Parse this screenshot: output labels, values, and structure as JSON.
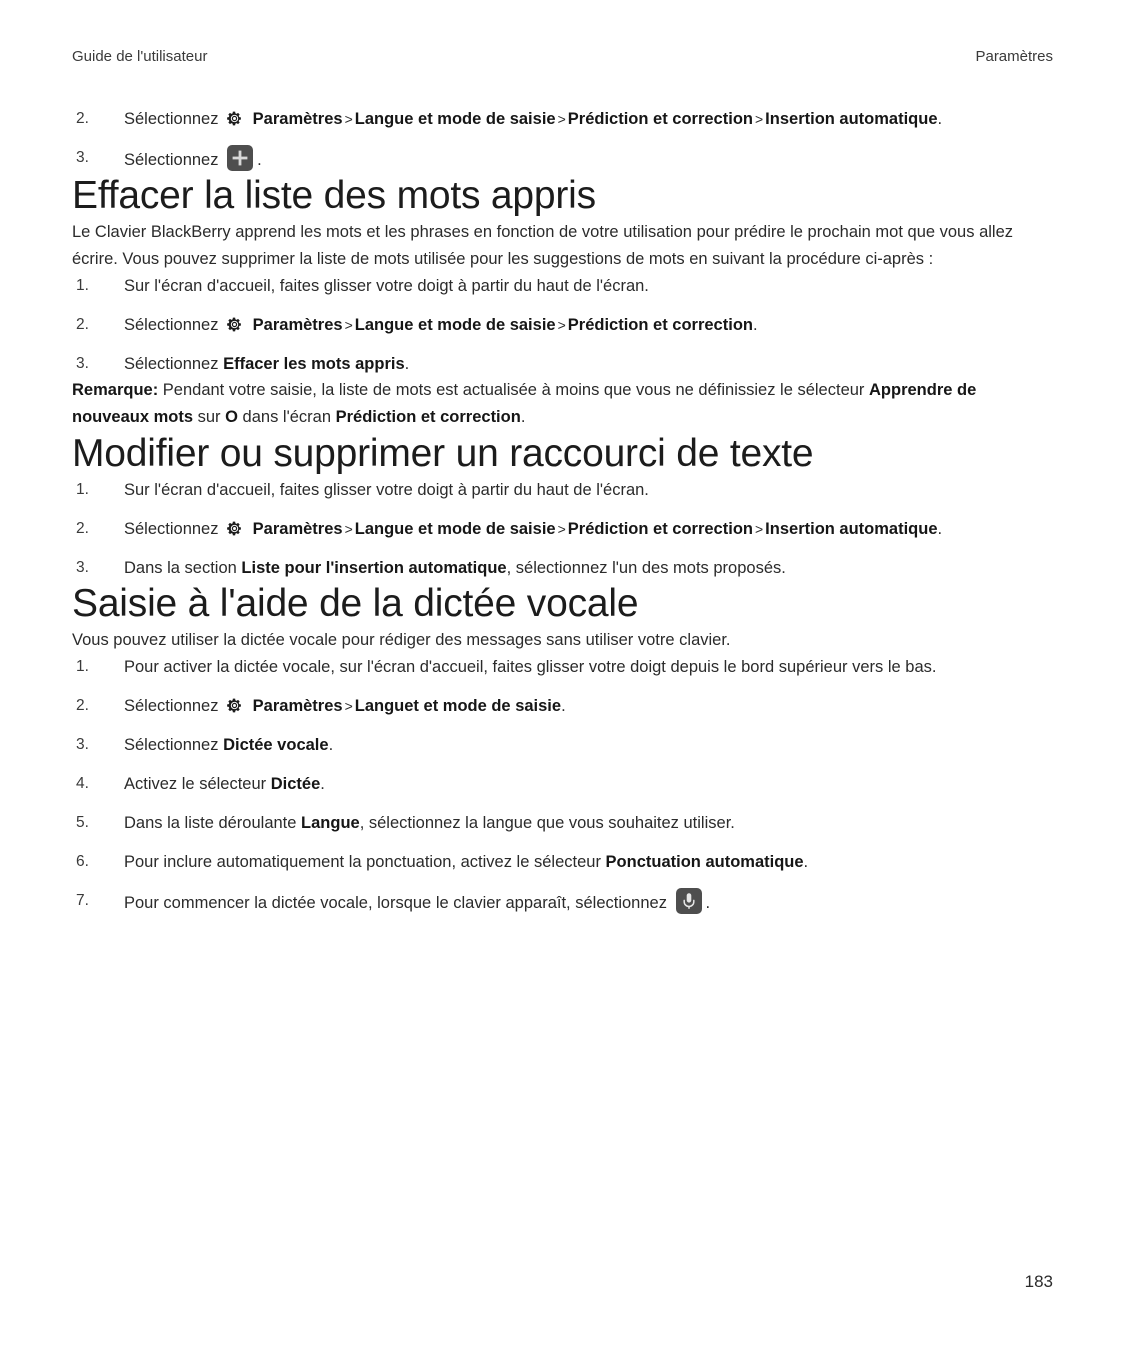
{
  "header": {
    "left": "Guide de l'utilisateur",
    "right": "Paramètres"
  },
  "footer": {
    "page_number": "183"
  },
  "icons": {
    "gear": "gear-icon",
    "plus_tile": "plus-icon",
    "microphone_tile": "microphone-icon"
  },
  "top_steps": {
    "items": [
      {
        "num": "2.",
        "lead": "Sélectionnez",
        "crumbs": [
          "Paramètres",
          "Langue et mode de saisie",
          "Prédiction et correction",
          "Insertion automatique"
        ],
        "separator": ">",
        "trailing": "."
      },
      {
        "num": "3.",
        "lead": "Sélectionnez",
        "trailing": "."
      }
    ]
  },
  "section_effacer": {
    "title": "Effacer la liste des mots appris",
    "intro": "Le Clavier BlackBerry apprend les mots et les phrases en fonction de votre utilisation pour prédire le prochain mot que vous allez écrire. Vous pouvez supprimer la liste de mots utilisée pour les suggestions de mots en suivant la procédure ci-après :",
    "steps": [
      {
        "num": "1.",
        "text": "Sur l'écran d'accueil, faites glisser votre doigt à partir du haut de l'écran."
      },
      {
        "num": "2.",
        "lead": "Sélectionnez",
        "crumbs": [
          "Paramètres",
          "Langue et mode de saisie",
          "Prédiction et correction"
        ],
        "separator": ">",
        "trailing": "."
      },
      {
        "num": "3.",
        "lead": "Sélectionnez",
        "bold": "Effacer les mots appris",
        "trailing": "."
      }
    ],
    "note": {
      "label": "Remarque:",
      "part1": " Pendant votre saisie, la liste de mots est actualisée à moins que vous ne définissiez le sélecteur ",
      "bold1": "Apprendre de nouveaux mots",
      "part2": " sur ",
      "bold2": "O",
      "part3": " dans l'écran ",
      "bold3": "Prédiction et correction",
      "part4": "."
    }
  },
  "section_modifier": {
    "title": "Modifier ou supprimer un raccourci de texte",
    "steps": [
      {
        "num": "1.",
        "text": "Sur l'écran d'accueil, faites glisser votre doigt à partir du haut de l'écran."
      },
      {
        "num": "2.",
        "lead": "Sélectionnez",
        "crumbs": [
          "Paramètres",
          "Langue et mode de saisie",
          "Prédiction et correction",
          "Insertion automatique"
        ],
        "separator": ">",
        "trailing": "."
      },
      {
        "num": "3.",
        "part1": "Dans la section ",
        "bold": "Liste pour l'insertion automatique",
        "part2": ", sélectionnez l'un des mots proposés."
      }
    ]
  },
  "section_saisie": {
    "title": "Saisie à l'aide de la dictée vocale",
    "intro": "Vous pouvez utiliser la dictée vocale pour rédiger des messages sans utiliser votre clavier.",
    "steps": [
      {
        "num": "1.",
        "text": "Pour activer la dictée vocale, sur l'écran d'accueil, faites glisser votre doigt depuis le bord supérieur vers le bas."
      },
      {
        "num": "2.",
        "lead": "Sélectionnez",
        "crumbs": [
          "Paramètres",
          "Languet et mode de saisie"
        ],
        "separator": ">",
        "trailing": "."
      },
      {
        "num": "3.",
        "lead": "Sélectionnez",
        "bold": "Dictée vocale",
        "trailing": "."
      },
      {
        "num": "4.",
        "part1": "Activez le sélecteur ",
        "bold": "Dictée",
        "part2": "."
      },
      {
        "num": "5.",
        "part1": "Dans la liste déroulante ",
        "bold": "Langue",
        "part2": ", sélectionnez la langue que vous souhaitez utiliser."
      },
      {
        "num": "6.",
        "part1": "Pour inclure automatiquement la ponctuation, activez le sélecteur ",
        "bold": "Ponctuation automatique",
        "part2": "."
      },
      {
        "num": "7.",
        "lead": "Pour commencer la dictée vocale, lorsque le clavier apparaît, sélectionnez",
        "trailing": "."
      }
    ]
  },
  "colors": {
    "page_background": "#ffffff",
    "body_text": "#2b2b2b",
    "heading_text": "#1c1c1c",
    "bold_text": "#161616",
    "icon_tile": "#4e4e4e",
    "icon_glyph": "#d8d8d8"
  }
}
